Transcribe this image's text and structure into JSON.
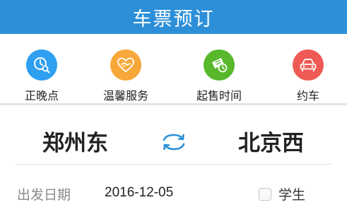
{
  "header": {
    "title": "车票预订"
  },
  "shortcuts": [
    {
      "label": "正晚点",
      "icon": "clock-search-icon",
      "color": "#2f9ff0"
    },
    {
      "label": "温馨服务",
      "icon": "handshake-heart-icon",
      "color": "#f7a83a"
    },
    {
      "label": "起售时间",
      "icon": "ticket-clock-icon",
      "color": "#58b82c"
    },
    {
      "label": "约车",
      "icon": "car-icon",
      "color": "#ef5a55"
    }
  ],
  "stations": {
    "from": "郑州东",
    "to": "北京西",
    "swap_icon": "swap-arrows-icon",
    "swap_color": "#2c8fd8"
  },
  "date": {
    "label": "出发日期",
    "value": "2016-12-05"
  },
  "student": {
    "label": "学生",
    "checked": false
  },
  "colors": {
    "header": "#2c8fd8",
    "divider": "#e3e3e3"
  }
}
